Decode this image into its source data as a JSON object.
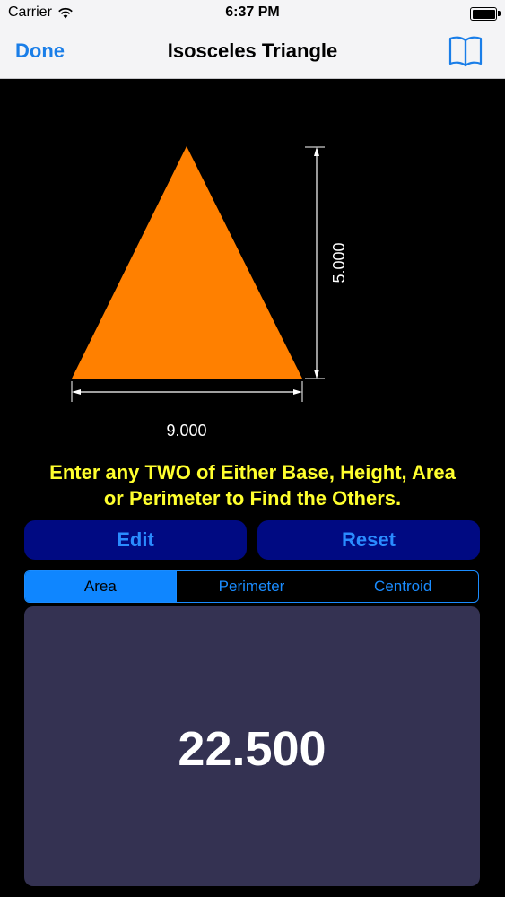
{
  "status": {
    "carrier": "Carrier",
    "time": "6:37 PM"
  },
  "nav": {
    "done_label": "Done",
    "title": "Isosceles Triangle",
    "book_icon": "book-icon"
  },
  "diagram": {
    "base_label": "9.000",
    "height_label": "5.000",
    "triangle_color": "#ff8000"
  },
  "instructions": {
    "line1": "Enter any TWO of Either Base, Height, Area",
    "line2": "or Perimeter to Find the Others."
  },
  "buttons": {
    "edit": "Edit",
    "reset": "Reset"
  },
  "tabs": [
    {
      "label": "Area",
      "selected": true
    },
    {
      "label": "Perimeter",
      "selected": false
    },
    {
      "label": "Centroid",
      "selected": false
    }
  ],
  "result": {
    "value": "22.500"
  },
  "colors": {
    "accent": "#1a8cff",
    "button_bg": "#000a82",
    "panel_bg": "#343252",
    "instruction_text": "#ffff2e"
  }
}
